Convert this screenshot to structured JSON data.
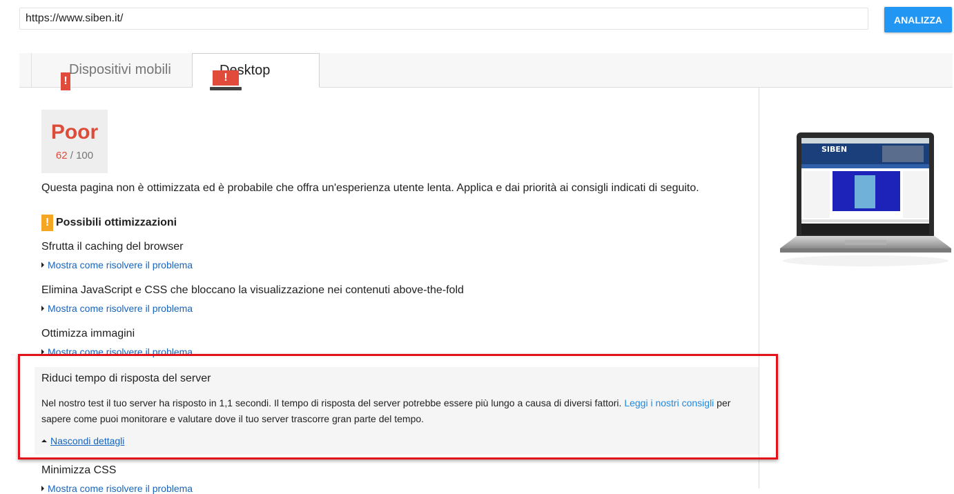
{
  "url_bar": {
    "value": "https://www.siben.it/"
  },
  "analyze_button": {
    "label": "ANALIZZA"
  },
  "tabs": [
    {
      "label": "Dispositivi mobili",
      "icon": "phone-warning-icon",
      "icon_mark": "!",
      "active": false
    },
    {
      "label": "Desktop",
      "icon": "laptop-warning-icon",
      "icon_mark": "!",
      "active": true
    }
  ],
  "score": {
    "label": "Poor",
    "value": "62",
    "max": "/ 100"
  },
  "summary": "Questa pagina non è ottimizzata ed è probabile che offra un'esperienza utente lenta. Applica e dai priorità ai consigli indicati di seguito.",
  "section": {
    "title": "Possibili ottimizzazioni",
    "icon_mark": "!",
    "icon": "warning-icon"
  },
  "rules": [
    {
      "title": "Sfrutta il caching del browser",
      "link": "Mostra come risolvere il problema"
    },
    {
      "title": "Elimina JavaScript e CSS che bloccano la visualizzazione nei contenuti above-the-fold",
      "link": "Mostra come risolvere il problema"
    },
    {
      "title": "Ottimizza immagini",
      "link": "Mostra come risolvere il problema"
    },
    {
      "title": "Minimizza CSS",
      "link": "Mostra come risolvere il problema"
    }
  ],
  "expanded_rule": {
    "title": "Riduci tempo di risposta del server",
    "desc_before": "Nel nostro test il tuo server ha risposto in 1,1 secondi. Il tempo di risposta del server potrebbe essere più lungo a causa di diversi fattori. ",
    "desc_link": "Leggi i nostri consigli",
    "desc_after": " per sapere come puoi monitorare e valutare dove il tuo server trascorre gran parte del tempo.",
    "hide_link": "Nascondi dettagli"
  },
  "preview": {
    "icon": "laptop-screenshot-preview",
    "site_name": "SIBEN"
  },
  "colors": {
    "accent": "#2196f3",
    "poor": "#dd4b39",
    "warning": "#f5a623",
    "link": "#1565c0",
    "highlight": "#e3121a"
  }
}
